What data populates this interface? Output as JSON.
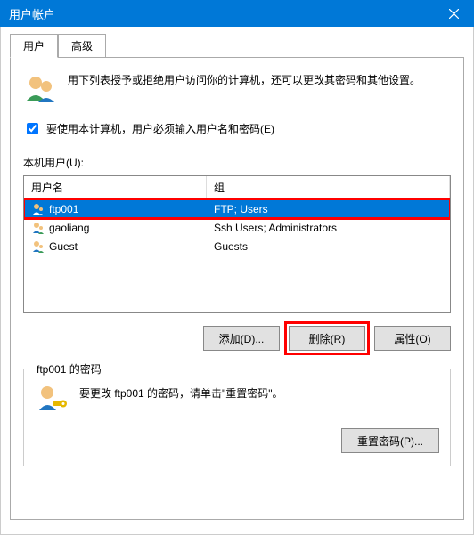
{
  "window": {
    "title": "用户帐户"
  },
  "tabs": {
    "users": "用户",
    "advanced": "高级"
  },
  "intro": "用下列表授予或拒绝用户访问你的计算机，还可以更改其密码和其他设置。",
  "checkbox": {
    "label": "要使用本计算机，用户必须输入用户名和密码(E)",
    "checked": true
  },
  "users_label": "本机用户(U):",
  "columns": {
    "name": "用户名",
    "group": "组"
  },
  "users": [
    {
      "name": "ftp001",
      "group": "FTP; Users",
      "selected": true
    },
    {
      "name": "gaoliang",
      "group": "Ssh Users; Administrators",
      "selected": false
    },
    {
      "name": "Guest",
      "group": "Guests",
      "selected": false
    }
  ],
  "buttons": {
    "add": "添加(D)...",
    "remove": "删除(R)",
    "props": "属性(O)"
  },
  "password_section": {
    "legend": "ftp001 的密码",
    "text": "要更改 ftp001 的密码，请单击\"重置密码\"。",
    "reset": "重置密码(P)..."
  }
}
